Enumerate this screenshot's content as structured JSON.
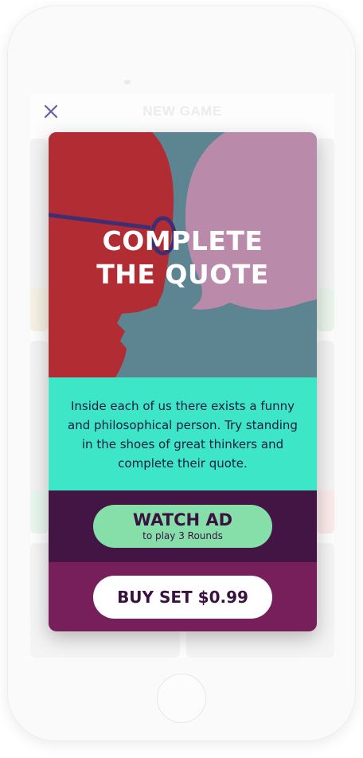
{
  "header": {
    "title": "NEW GAME",
    "close_icon": "close-icon",
    "accent": "#6b5da8"
  },
  "modal": {
    "hero_title_line1": "COMPLETE",
    "hero_title_line2": "THE QUOTE",
    "hero_illustration": "profiles-and-speech-bubble-illustration",
    "description": "Inside each of us there exists a funny and philosophical person. Try standing in the shoes of great thinkers and complete their quote.",
    "watch_ad": {
      "label": "WATCH AD",
      "sublabel": "to play 3 Rounds"
    },
    "buy": {
      "label": "BUY SET $0.99"
    },
    "colors": {
      "hero_bg": "#5c8591",
      "face": "#b12c33",
      "bubble": "#b98aaa",
      "description_bg": "#3de6c6",
      "ad_band": "#421545",
      "watch_button": "#86dfa9",
      "buy_band": "#761f5b",
      "buy_button": "#ffffff",
      "text_dark": "#3a1241"
    }
  }
}
